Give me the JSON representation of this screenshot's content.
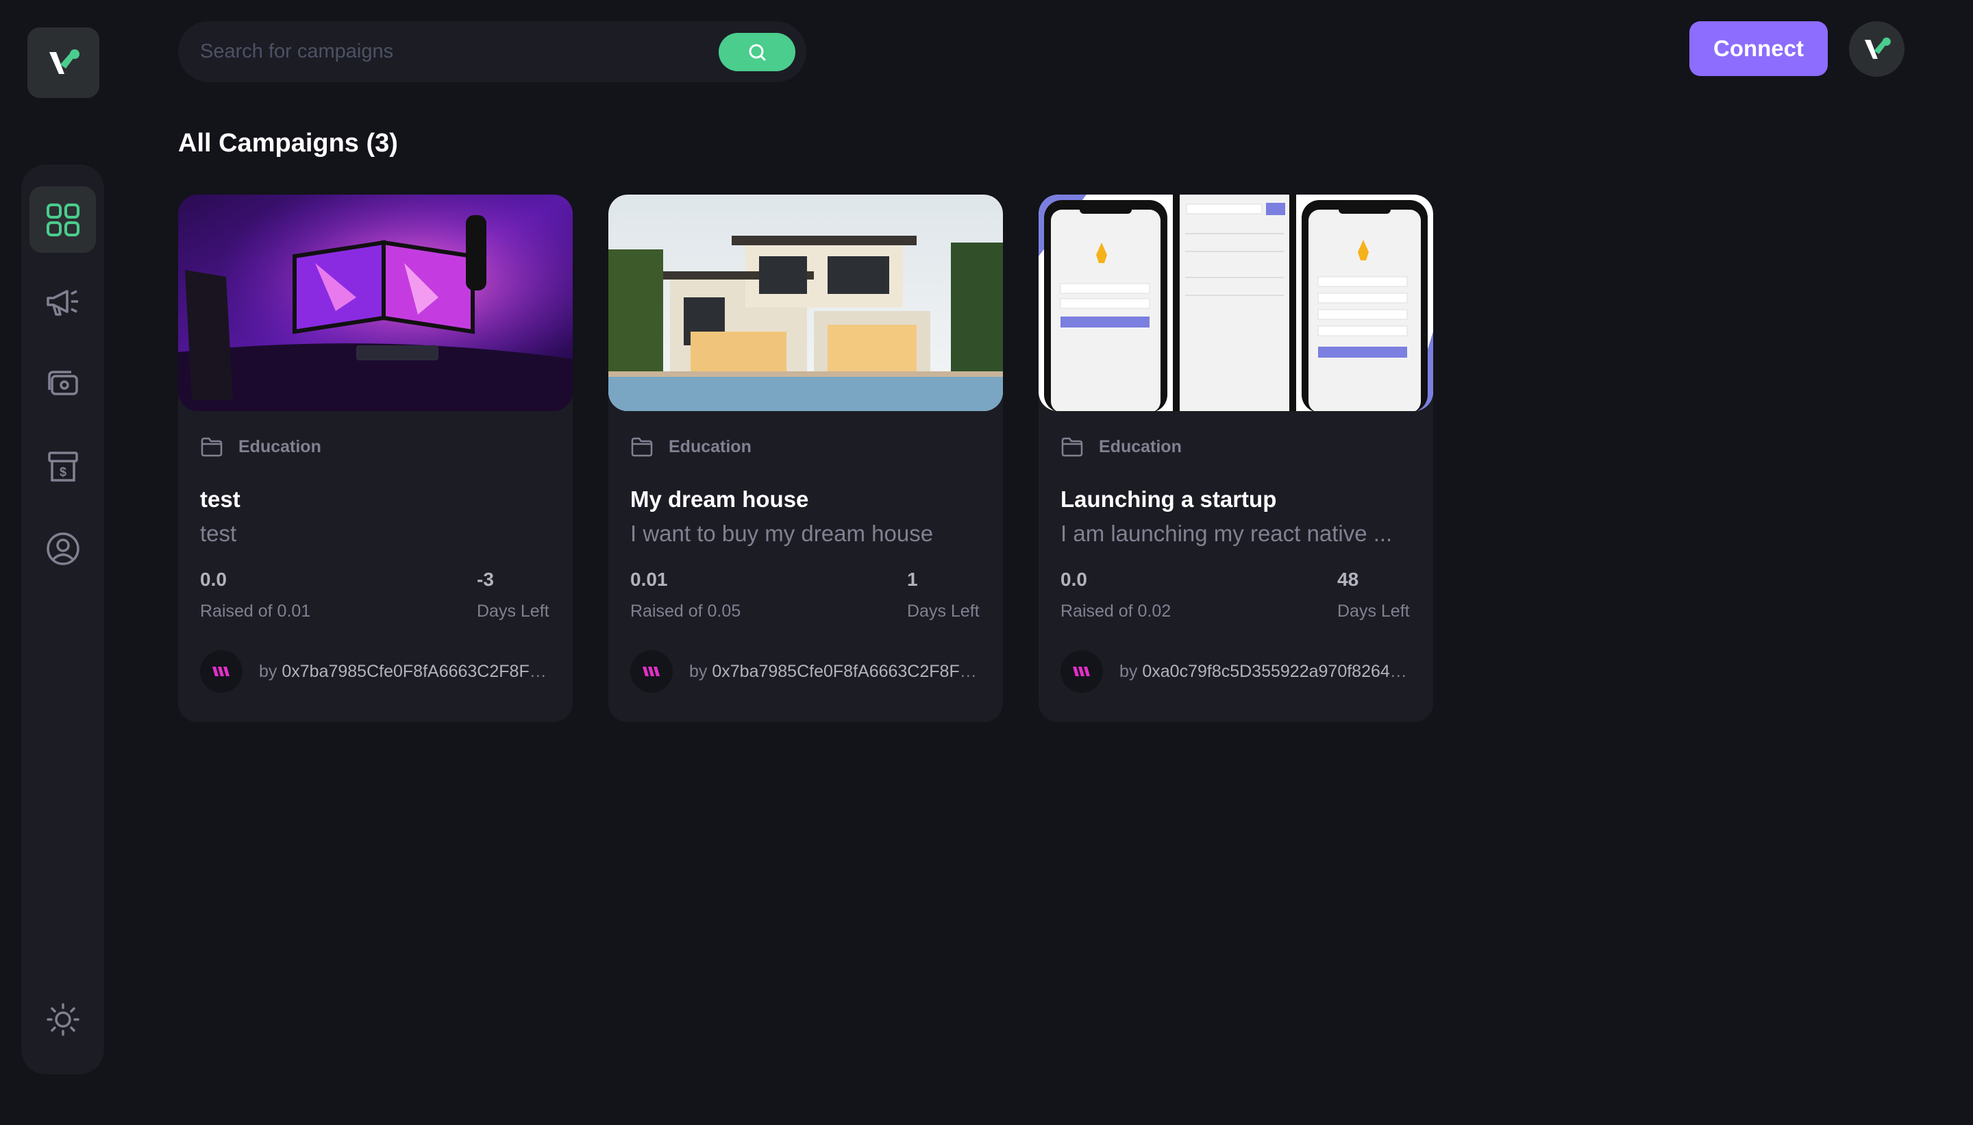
{
  "search": {
    "placeholder": "Search for campaigns"
  },
  "header": {
    "connect_label": "Connect"
  },
  "colors": {
    "accent_green": "#4acd8d",
    "accent_purple": "#8c6dfd",
    "background": "#13131a",
    "card": "#1c1c24"
  },
  "sidebar": {
    "items": [
      {
        "icon": "dashboard-icon",
        "active": true
      },
      {
        "icon": "campaign-icon",
        "active": false
      },
      {
        "icon": "payment-icon",
        "active": false
      },
      {
        "icon": "withdraw-icon",
        "active": false
      },
      {
        "icon": "profile-icon",
        "active": false
      }
    ],
    "theme_icon": "sun-icon"
  },
  "main": {
    "title": "All Campaigns (3)",
    "campaigns": [
      {
        "category": "Education",
        "title": "test",
        "description": "test",
        "amount_collected": "0.0",
        "raised_label": "Raised of 0.01",
        "days_left": "-3",
        "days_label": "Days Left",
        "owner_prefix": "by ",
        "owner": "0x7ba7985Cfe0F8fA6663C2F8Fc..."
      },
      {
        "category": "Education",
        "title": "My dream house",
        "description": "I want to buy my dream house",
        "amount_collected": "0.01",
        "raised_label": "Raised of 0.05",
        "days_left": "1",
        "days_label": "Days Left",
        "owner_prefix": "by ",
        "owner": "0x7ba7985Cfe0F8fA6663C2F8Fc..."
      },
      {
        "category": "Education",
        "title": "Launching a startup",
        "description": "I am launching my react native ...",
        "amount_collected": "0.0",
        "raised_label": "Raised of 0.02",
        "days_left": "48",
        "days_label": "Days Left",
        "owner_prefix": "by ",
        "owner": "0xa0c79f8c5D355922a970f8264f..."
      }
    ]
  }
}
